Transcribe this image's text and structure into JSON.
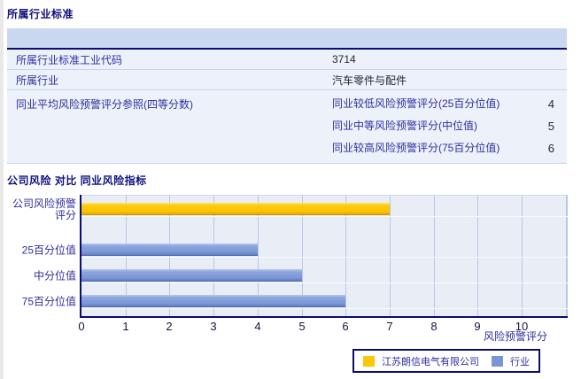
{
  "section1": {
    "title": "所属行业标准",
    "rows": [
      {
        "label": "所属行业标准工业代码",
        "value": "3714"
      },
      {
        "label": "所属行业",
        "value": "汽车零件与配件"
      }
    ],
    "quartile_row": {
      "label": "同业平均风险预警评分参照(四等分数)",
      "items": [
        {
          "label": "同业较低风险预警评分(25百分位值)",
          "value": "4"
        },
        {
          "label": "同业中等风险预警评分(中位值)",
          "value": "5"
        },
        {
          "label": "同业较高风险预警评分(75百分位值)",
          "value": "6"
        }
      ]
    }
  },
  "section2": {
    "title": "公司风险 对比 同业风险指标"
  },
  "chart_data": {
    "type": "bar",
    "orientation": "horizontal",
    "title": "公司风险 对比 同业风险指标",
    "categories": [
      "公司风险预警评分",
      "25百分位值",
      "中分位值",
      "75百分位值"
    ],
    "series": [
      {
        "name": "江苏朗信电气有限公司",
        "color": "#fdc606",
        "values": [
          7,
          null,
          null,
          null
        ]
      },
      {
        "name": "行业",
        "color": "#7b96d6",
        "values": [
          null,
          4,
          5,
          6
        ]
      }
    ],
    "xlabel": "风险预警评分",
    "xlim": [
      0,
      11
    ],
    "xticks": [
      0,
      1,
      2,
      3,
      4,
      5,
      6,
      7,
      8,
      9,
      10
    ],
    "grid": true,
    "gridline_color": "#b9c8e4",
    "plot_background": "#e9edf5",
    "axis_color": "#0b0b72",
    "legend_position": "bottom-right"
  }
}
